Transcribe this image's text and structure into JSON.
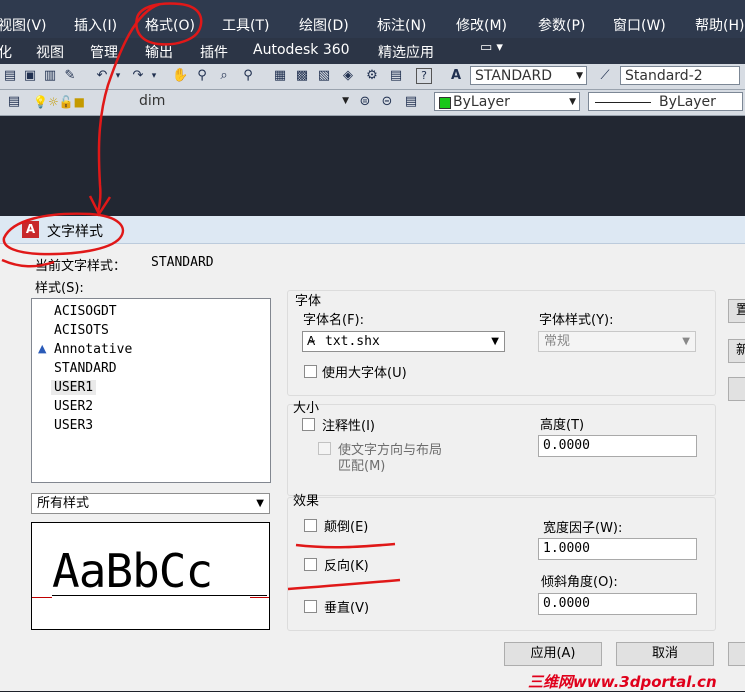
{
  "menubar": {
    "items": [
      "视图(V)",
      "插入(I)",
      "格式(O)",
      "工具(T)",
      "绘图(D)",
      "标注(N)",
      "修改(M)",
      "参数(P)",
      "窗口(W)",
      "帮助(H)"
    ]
  },
  "ribbon": {
    "tabs": [
      "化",
      "视图",
      "管理",
      "输出",
      "插件",
      "Autodesk 360",
      "精选应用"
    ]
  },
  "toolbar": {
    "text_style": "STANDARD",
    "dim_style": "Standard-2",
    "layer": "dim",
    "color": "ByLayer",
    "linetype": "ByLayer"
  },
  "dialog": {
    "title": "文字样式",
    "current_style_label": "当前文字样式：",
    "current_style_value": "STANDARD",
    "styles_label": "样式(S):",
    "styles": [
      "ACISOGDT",
      "ACISOTS",
      "Annotative",
      "STANDARD",
      "USER1",
      "USER2",
      "USER3"
    ],
    "selected_style": "USER1",
    "filter_value": "所有样式",
    "preview_text": "AaBbCc",
    "font_group": {
      "title": "字体",
      "font_name_label": "字体名(F):",
      "font_name_value": "txt.shx",
      "font_style_label": "字体样式(Y):",
      "font_style_value": "常规",
      "big_font_label": "使用大字体(U)"
    },
    "size_group": {
      "title": "大小",
      "annotative_label": "注释性(I)",
      "match_orientation_line1": "使文字方向与布局",
      "match_orientation_line2": "匹配(M)",
      "height_label": "高度(T)",
      "height_value": "0.0000"
    },
    "effects_group": {
      "title": "效果",
      "upside_down_label": "颠倒(E)",
      "backwards_label": "反向(K)",
      "vertical_label": "垂直(V)",
      "width_factor_label": "宽度因子(W):",
      "width_factor_value": "1.0000",
      "oblique_label": "倾斜角度(O):",
      "oblique_value": "0.0000"
    },
    "side_buttons": [
      "置",
      "新",
      ""
    ],
    "apply_button": "应用(A)",
    "cancel_button": "取消"
  },
  "watermark": "三维网www.3dportal.cn",
  "colors": {
    "annotation": "#e01818",
    "title_bar": "#dde8f3",
    "menubar": "#2f3a4e"
  }
}
